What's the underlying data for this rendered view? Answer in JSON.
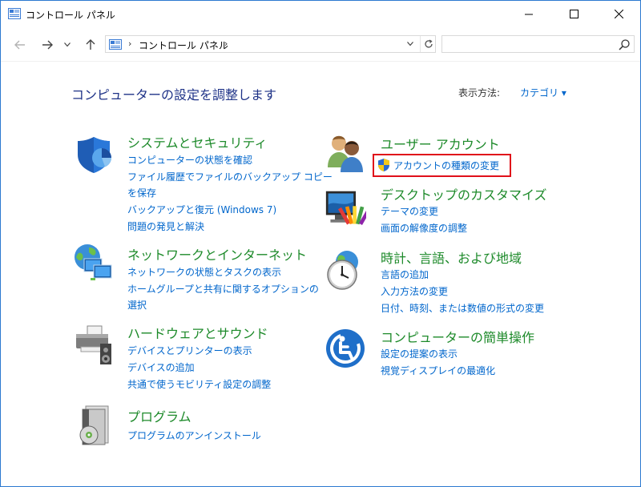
{
  "window": {
    "title": "コントロール パネル",
    "minimize_glyph": "—",
    "maximize_glyph": "☐",
    "close_glyph": "✕"
  },
  "nav": {
    "back_icon": "back-arrow-icon",
    "forward_icon": "forward-arrow-icon",
    "recent_icon": "chevron-down-icon",
    "up_icon": "up-arrow-icon",
    "address_path": "コントロール パネル",
    "search_placeholder": ""
  },
  "main": {
    "heading": "コンピューターの設定を調整します",
    "view_by_label": "表示方法:",
    "view_by_value": "カテゴリ ▾"
  },
  "categories": [
    {
      "title": "システムとセキュリティ",
      "icon": "shield-icon",
      "links": [
        "コンピューターの状態を確認",
        "ファイル履歴でファイルのバックアップ コピー",
        "を保存",
        "バックアップと復元 (Windows 7)",
        "問題の発見と解決"
      ]
    },
    {
      "title": "ネットワークとインターネット",
      "icon": "network-icon",
      "links": [
        "ネットワークの状態とタスクの表示",
        "ホームグループと共有に関するオプションの",
        "選択"
      ]
    },
    {
      "title": "ハードウェアとサウンド",
      "icon": "printer-icon",
      "links": [
        "デバイスとプリンターの表示",
        "デバイスの追加",
        "共通で使うモビリティ設定の調整"
      ]
    },
    {
      "title": "プログラム",
      "icon": "programs-icon",
      "links": [
        "プログラムのアンインストール"
      ]
    },
    {
      "title": "ユーザー アカウント",
      "icon": "users-icon",
      "links": [
        "アカウントの種類の変更"
      ]
    },
    {
      "title": "デスクトップのカスタマイズ",
      "icon": "monitor-icon",
      "links": [
        "テーマの変更",
        "画面の解像度の調整"
      ]
    },
    {
      "title": "時計、言語、および地域",
      "icon": "clock-icon",
      "links": [
        "言語の追加",
        "入力方法の変更",
        "日付、時刻、または数値の形式の変更"
      ]
    },
    {
      "title": "コンピューターの簡単操作",
      "icon": "ease-of-access-icon",
      "links": [
        "設定の提案の表示",
        "視覚ディスプレイの最適化"
      ]
    }
  ],
  "colors": {
    "heading": "#1e3287",
    "category_title": "#1d8a2a",
    "link": "#0066cc",
    "highlight": "#e0101a"
  }
}
